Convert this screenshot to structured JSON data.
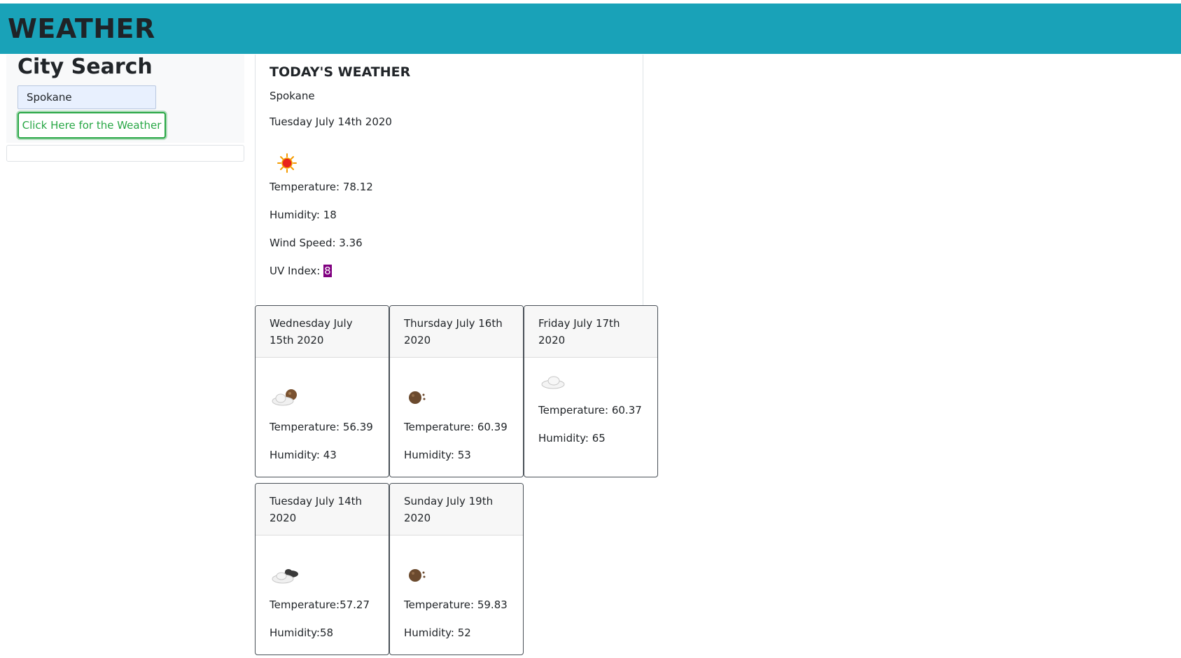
{
  "app": {
    "title": "WEATHER"
  },
  "search": {
    "heading": "City Search",
    "input_value": "Spokane",
    "button_label": "Click Here for the Weather"
  },
  "today": {
    "heading": "TODAY'S WEATHER",
    "city": "Spokane",
    "date": "Tuesday July 14th 2020",
    "icon": "sun-icon",
    "temperature": "Temperature: 78.12",
    "humidity": "Humidity: 18",
    "wind": "Wind Speed: 3.36",
    "uv_label": "UV Index: ",
    "uv_value": "8",
    "uv_color": "#800080"
  },
  "forecast": [
    {
      "date": "Wednesday July 15th 2020",
      "icon": "cloud-moon-icon",
      "temperature": "Temperature: 56.39",
      "humidity": "Humidity: 43"
    },
    {
      "date": "Thursday July 16th 2020",
      "icon": "moon-icon",
      "temperature": "Temperature: 60.39",
      "humidity": "Humidity: 53"
    },
    {
      "date": "Friday July 17th 2020",
      "icon": "cloud-icon",
      "temperature": "Temperature: 60.37",
      "humidity": "Humidity: 65"
    },
    {
      "date": "Tuesday July 14th 2020",
      "icon": "broken-clouds-icon",
      "temperature": "Temperature:57.27",
      "humidity": "Humidity:58"
    },
    {
      "date": "Sunday July 19th 2020",
      "icon": "moon-icon",
      "temperature": "Temperature: 59.83",
      "humidity": "Humidity: 52"
    }
  ],
  "colors": {
    "header": "#19a2b8",
    "button": "#28a745"
  }
}
